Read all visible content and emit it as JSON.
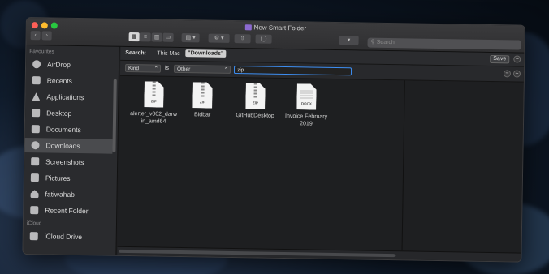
{
  "window": {
    "title": "New Smart Folder"
  },
  "toolbar": {
    "search_placeholder": "Search"
  },
  "sidebar": {
    "favourites_label": "Favourites",
    "icloud_label": "iCloud",
    "items": [
      {
        "label": "AirDrop",
        "icon": "airdrop-icon"
      },
      {
        "label": "Recents",
        "icon": "clock-icon"
      },
      {
        "label": "Applications",
        "icon": "applications-icon"
      },
      {
        "label": "Desktop",
        "icon": "desktop-icon"
      },
      {
        "label": "Documents",
        "icon": "documents-icon"
      },
      {
        "label": "Downloads",
        "icon": "downloads-icon"
      },
      {
        "label": "Screenshots",
        "icon": "folder-icon"
      },
      {
        "label": "Pictures",
        "icon": "camera-icon"
      },
      {
        "label": "fatiwahab",
        "icon": "home-icon"
      },
      {
        "label": "Recent Folder",
        "icon": "folder-icon"
      },
      {
        "label": "iCloud Drive",
        "icon": "cloud-folder-icon"
      }
    ]
  },
  "scope": {
    "label": "Search:",
    "this_mac": "This Mac",
    "downloads": "\"Downloads\"",
    "save": "Save"
  },
  "criteria": {
    "attribute": "Kind",
    "operator": "is",
    "value": "Other",
    "text": "zip"
  },
  "files": [
    {
      "name": "alerter_v002_darwin_amd64",
      "line1": "alerter_v002_darw",
      "line2": "in_amd64",
      "tag": "ZIP"
    },
    {
      "name": "Bidbar",
      "line1": "Bidbar",
      "line2": "",
      "tag": "ZIP"
    },
    {
      "name": "GitHubDesktop",
      "line1": "GitHubDesktop",
      "line2": "",
      "tag": "ZIP"
    },
    {
      "name": "Invoice February 2019",
      "line1": "Invoice February",
      "line2": "2019",
      "tag": "DOCX"
    }
  ]
}
